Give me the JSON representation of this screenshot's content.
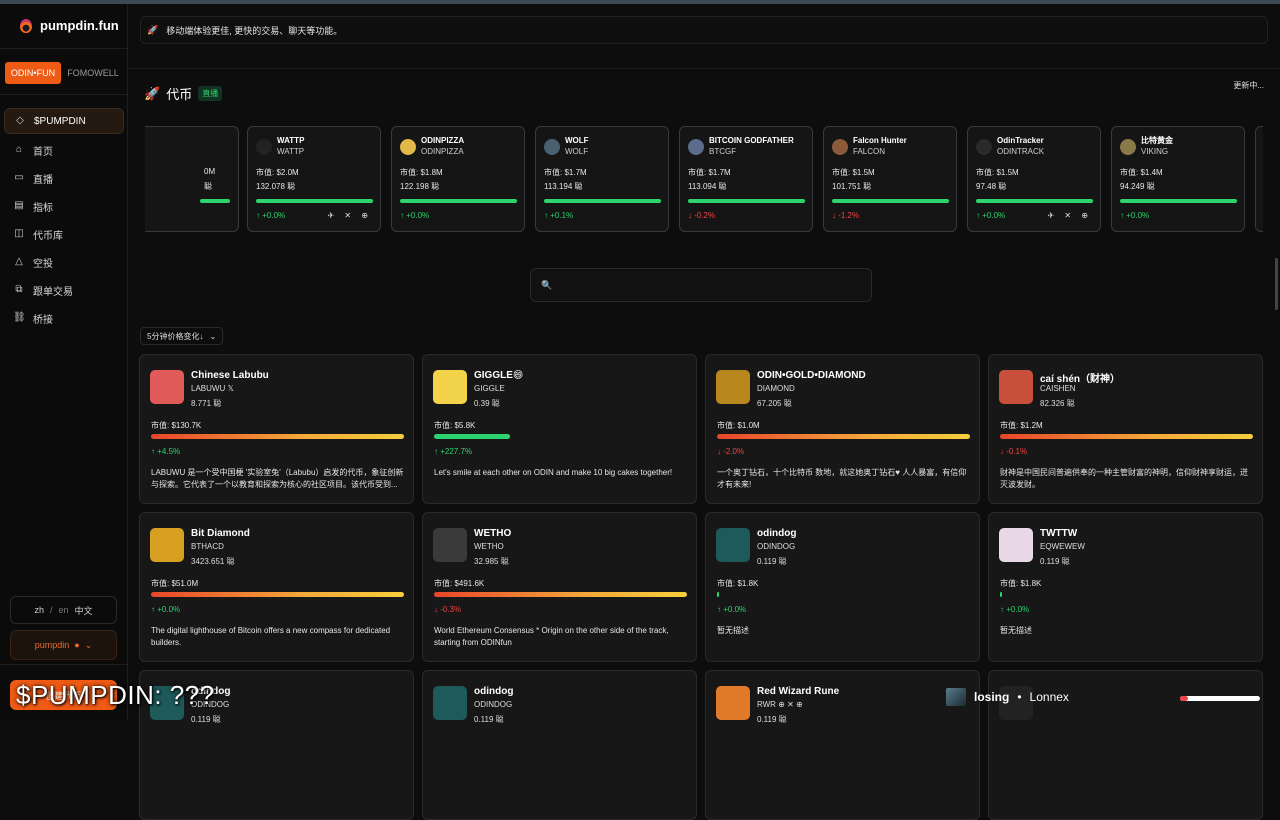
{
  "app": {
    "name": "pumpdin.fun"
  },
  "sidebar": {
    "platforms": [
      "ODIN•FUN",
      "FOMOWELL"
    ],
    "items": [
      {
        "label": "$PUMPDIN",
        "icon": "diamond-icon"
      },
      {
        "label": "首页",
        "icon": "home-icon"
      },
      {
        "label": "直播",
        "icon": "video-icon"
      },
      {
        "label": "指标",
        "icon": "chart-icon"
      },
      {
        "label": "代币库",
        "icon": "library-icon"
      },
      {
        "label": "空投",
        "icon": "airdrop-icon"
      },
      {
        "label": "跟单交易",
        "icon": "copy-icon"
      },
      {
        "label": "桥接",
        "icon": "link-icon"
      }
    ],
    "lang": {
      "zh": "zh",
      "sep": "/",
      "en": "en",
      "current": "中文"
    },
    "user": "pumpdin",
    "bottom_button": "创建代币"
  },
  "notice": {
    "text": "移动端体验更佳, 更快的交易、聊天等功能。"
  },
  "section": {
    "title": "代币",
    "badge": "直播",
    "updating": "更新中..."
  },
  "ticker": [
    {
      "name": "",
      "symbol": "",
      "mc": "0M",
      "vol": "聪",
      "change": "",
      "dir": "up",
      "socials": "",
      "color": "#333"
    },
    {
      "name": "WATTP",
      "symbol": "WATTP",
      "mc": "市值: $2.0M",
      "vol": "132.078 聪",
      "change": "↑ +0.0%",
      "dir": "up",
      "socials": "✈ ✕ ⊕",
      "color": "#222"
    },
    {
      "name": "ODINPIZZA",
      "symbol": "ODINPIZZA",
      "mc": "市值: $1.8M",
      "vol": "122.198 聪",
      "change": "↑ +0.0%",
      "dir": "up",
      "socials": "",
      "color": "#e2b84a"
    },
    {
      "name": "WOLF",
      "symbol": "WOLF",
      "mc": "市值: $1.7M",
      "vol": "113.194 聪",
      "change": "↑ +0.1%",
      "dir": "up",
      "socials": "",
      "color": "#4a6070"
    },
    {
      "name": "BITCOIN GODFATHER",
      "symbol": "BTCGF",
      "mc": "市值: $1.7M",
      "vol": "113.094 聪",
      "change": "↓ -0.2%",
      "dir": "down",
      "socials": "",
      "color": "#5a6b8c"
    },
    {
      "name": "Falcon Hunter",
      "symbol": "FALCON",
      "mc": "市值: $1.5M",
      "vol": "101.751 聪",
      "change": "↓ -1.2%",
      "dir": "down",
      "socials": "",
      "color": "#8a5a3a"
    },
    {
      "name": "OdinTracker",
      "symbol": "ODINTRACK",
      "mc": "市值: $1.5M",
      "vol": "97.48 聪",
      "change": "↑ +0.0%",
      "dir": "up",
      "socials": "✈ ✕ ⊕",
      "color": "#2a2a2a"
    },
    {
      "name": "比特黄金",
      "symbol": "VIKING",
      "mc": "市值: $1.4M",
      "vol": "94.249 聪",
      "change": "↑ +0.0%",
      "dir": "up",
      "socials": "",
      "color": "#8a7a4a"
    }
  ],
  "search": {
    "placeholder": ""
  },
  "sort": {
    "label": "5分钟价格变化↓",
    "chevron": "⌄"
  },
  "cards": [
    {
      "name": "Chinese Labubu",
      "symbol": "LABUWU  𝕏",
      "vol": "8.771 聪",
      "mc": "市值: $130.7K",
      "change": "↑ +4.5%",
      "dir": "up",
      "bar": "grad",
      "fill": 1.0,
      "desc": "LABUWU 是一个受中国梗 '实验室兔'（Labubu）启发的代币，象征创新与探索。它代表了一个以教育和探索为核心的社区项目。该代币受到...",
      "color": "#e05a5a"
    },
    {
      "name": "GIGGLE😄",
      "symbol": "GIGGLE",
      "vol": "0.39 聪",
      "mc": "市值: $5.8K",
      "change": "↑ +227.7%",
      "dir": "up",
      "bar": "gbar",
      "fill": 0.3,
      "desc": "Let's smile at each other on ODIN and make 10 big cakes together!",
      "color": "#f2d34a"
    },
    {
      "name": "ODIN•GOLD•DIAMOND",
      "symbol": "DIAMOND",
      "vol": "67.205 聪",
      "mc": "市值: $1.0M",
      "change": "↓ -2.0%",
      "dir": "down",
      "bar": "grad",
      "fill": 1.0,
      "desc": "一个奥丁钻石，十个比特币 数地，就这她奥丁钻石♥ 人人暴富，有信仰才有未来!",
      "color": "#b8871e"
    },
    {
      "name": "caí shén（财神）",
      "symbol": "CAISHEN",
      "vol": "82.326 聪",
      "mc": "市值: $1.2M",
      "change": "↓ -0.1%",
      "dir": "down",
      "bar": "grad",
      "fill": 1.0,
      "desc": "财神是中国民间普遍供奉的一种主管财富的神明，信仰财神享财运，迸灭波发财。",
      "color": "#c8503a"
    },
    {
      "name": "Bit Diamond",
      "symbol": "BTHACD",
      "vol": "3423.651 聪",
      "mc": "市值: $51.0M",
      "change": "↑ +0.0%",
      "dir": "up",
      "bar": "grad",
      "fill": 1.0,
      "desc": "The digital lighthouse of Bitcoin offers a new compass for dedicated builders.",
      "color": "#d8a020"
    },
    {
      "name": "WETHO",
      "symbol": "WETHO",
      "vol": "32.985 聪",
      "mc": "市值: $491.6K",
      "change": "↓ -0.3%",
      "dir": "down",
      "bar": "grad",
      "fill": 1.0,
      "desc": "World Ethereum Consensus * Origin on the other side of the track, starting from ODINfun",
      "color": "#3a3a3a"
    },
    {
      "name": "odindog",
      "symbol": "ODINDOG",
      "vol": "0.119 聪",
      "mc": "市值: $1.8K",
      "change": "↑ +0.0%",
      "dir": "up",
      "bar": "gbar",
      "fill": 0.004,
      "desc": "暂无描述",
      "color": "#1e5a5a"
    },
    {
      "name": "TWTTW",
      "symbol": "EQWEWEW",
      "vol": "0.119 聪",
      "mc": "市值: $1.8K",
      "change": "↑ +0.0%",
      "dir": "up",
      "bar": "gbar",
      "fill": 0.004,
      "desc": "暂无描述",
      "color": "#e8d8e8"
    },
    {
      "name": "odindog",
      "symbol": "ODINDOG",
      "vol": "0.119 聪",
      "mc": "",
      "change": "",
      "dir": "up",
      "bar": "gbar",
      "fill": 0,
      "desc": "",
      "color": "#1e5a5a"
    },
    {
      "name": "odindog",
      "symbol": "ODINDOG",
      "vol": "0.119 聪",
      "mc": "",
      "change": "",
      "dir": "up",
      "bar": "gbar",
      "fill": 0,
      "desc": "",
      "color": "#1e5a5a"
    },
    {
      "name": "Red Wizard Rune",
      "symbol": "RWR  ⊕ ✕ ⊕",
      "vol": "0.119 聪",
      "mc": "",
      "change": "",
      "dir": "up",
      "bar": "gbar",
      "fill": 0,
      "desc": "",
      "color": "#e07a2a"
    },
    {
      "name": "",
      "symbol": "",
      "vol": "",
      "mc": "",
      "change": "",
      "dir": "up",
      "bar": "gbar",
      "fill": 0,
      "desc": "",
      "color": "#222"
    }
  ],
  "overlay": {
    "left": "$PUMPDIN: ???",
    "right_a": "losing",
    "right_sep": "•",
    "right_b": "Lonnex"
  }
}
